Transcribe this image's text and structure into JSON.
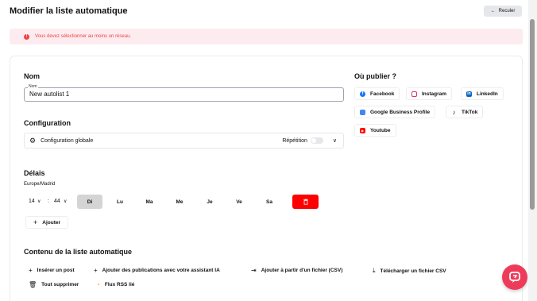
{
  "header": {
    "title": "Modifier la liste automatique",
    "back_label": "Reculer"
  },
  "alert": {
    "message": "Vous devez sélectionner au moins un réseau."
  },
  "name_section": {
    "title": "Nom",
    "field_label": "Nom",
    "field_value": "New autolist 1"
  },
  "publish_section": {
    "title": "Où publier ?",
    "networks": [
      {
        "label": "Facebook",
        "icon": "facebook-icon",
        "color": "#1877f2"
      },
      {
        "label": "Instagram",
        "icon": "instagram-icon",
        "color": "#e1306c"
      },
      {
        "label": "LinkedIn",
        "icon": "linkedin-icon",
        "color": "#0a66c2"
      },
      {
        "label": "Google Business Profile",
        "icon": "google-business-icon",
        "color": "#4285f4"
      },
      {
        "label": "TikTok",
        "icon": "tiktok-icon",
        "color": "#111111"
      },
      {
        "label": "Youtube",
        "icon": "youtube-icon",
        "color": "#ff0000"
      }
    ]
  },
  "config_section": {
    "title": "Configuration",
    "global_label": "Configuration globale",
    "repeat_label": "Répétition"
  },
  "delays_section": {
    "title": "Délais",
    "timezone": "Europe/Madrid",
    "hour": "14",
    "minute": "44",
    "separator": ":",
    "days": [
      "Di",
      "Lu",
      "Ma",
      "Me",
      "Je",
      "Ve",
      "Sa"
    ],
    "active_day": "Di",
    "add_label": "Ajouter"
  },
  "content_section": {
    "title": "Contenu de la liste automatique",
    "actions": [
      {
        "label": "Insérer un post",
        "icon": "plus-icon"
      },
      {
        "label": "Ajouter des publications avec votre assistant IA",
        "icon": "plus-icon"
      },
      {
        "label": "Ajouter à partir d'un fichier (CSV)",
        "icon": "file-import-icon"
      },
      {
        "label": "Télécharger un fichier CSV",
        "icon": "download-icon"
      },
      {
        "label": "Tout supprimer",
        "icon": "trash-icon"
      },
      {
        "label": "Flux RSS lié",
        "icon": "rss-icon"
      }
    ]
  },
  "colors": {
    "accent": "#ef3b5a",
    "delete": "#ff0000",
    "alert_bg": "#fdecef",
    "alert_text": "#ef4444"
  }
}
